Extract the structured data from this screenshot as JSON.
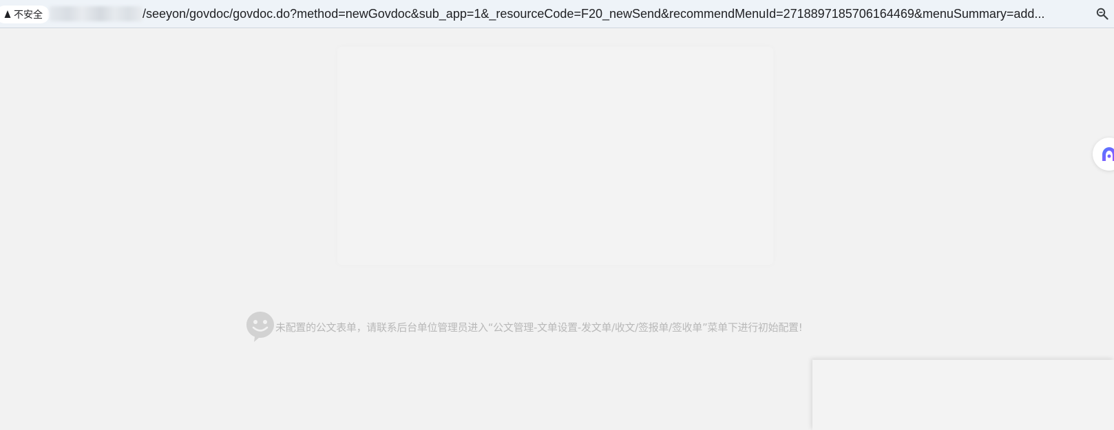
{
  "browser": {
    "security_label": "不安全",
    "security_icon": "warning-triangle-icon",
    "url_path": "/seeyon/govdoc/govdoc.do?method=newGovdoc&sub_app=1&_resourceCode=F20_newSend&recommendMenuId=2718897185706164469&menuSummary=add...",
    "zoom_icon": "zoom-icon"
  },
  "main": {
    "notice_icon": "smiley-icon",
    "notice_text": "未配置的公文表单，请联系后台单位管理员进入“公文管理-文单设置-发文单/收文/签报单/签收单”菜单下进行初始配置!"
  },
  "side_widget": {
    "icon": "assistant-icon"
  },
  "colors": {
    "page_background": "#f2f2f2",
    "address_bar": "#eef3f8",
    "notice_text": "#b8b8b8",
    "smiley": "#d2d2d2"
  }
}
